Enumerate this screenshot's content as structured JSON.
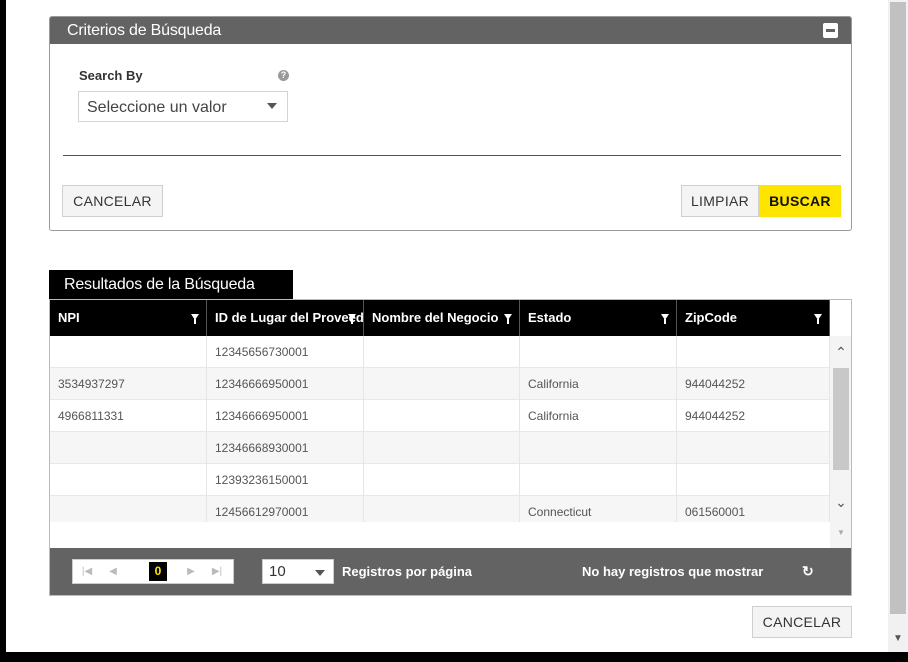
{
  "criteria": {
    "title": "Criterios de Búsqueda",
    "search_by_label": "Search By",
    "select_value": "Seleccione un valor",
    "cancel_label": "CANCELAR",
    "clear_label": "LIMPIAR",
    "search_label": "BUSCAR"
  },
  "results": {
    "title": "Resultados de la Búsqueda",
    "columns": [
      "NPI",
      "ID de Lugar del Proveedor",
      "Nombre del Negocio",
      "Estado",
      "ZipCode"
    ],
    "rows": [
      [
        "",
        "12345656730001",
        "",
        "",
        ""
      ],
      [
        "3534937297",
        "12346666950001",
        "",
        "California",
        "944044252"
      ],
      [
        "4966811331",
        "12346666950001",
        "",
        "California",
        "944044252"
      ],
      [
        "",
        "12346668930001",
        "",
        "",
        ""
      ],
      [
        "",
        "12393236150001",
        "",
        "",
        ""
      ],
      [
        "",
        "12456612970001",
        "",
        "Connecticut",
        "061560001"
      ]
    ]
  },
  "pager": {
    "current_page": "0",
    "page_size": "10",
    "page_size_label": "Registros por página",
    "info": "No hay registros que mostrar"
  },
  "footer": {
    "cancel_label": "CANCELAR"
  },
  "colors": {
    "accent": "#fde500",
    "header_gray": "#636363",
    "header_black": "#000000"
  }
}
